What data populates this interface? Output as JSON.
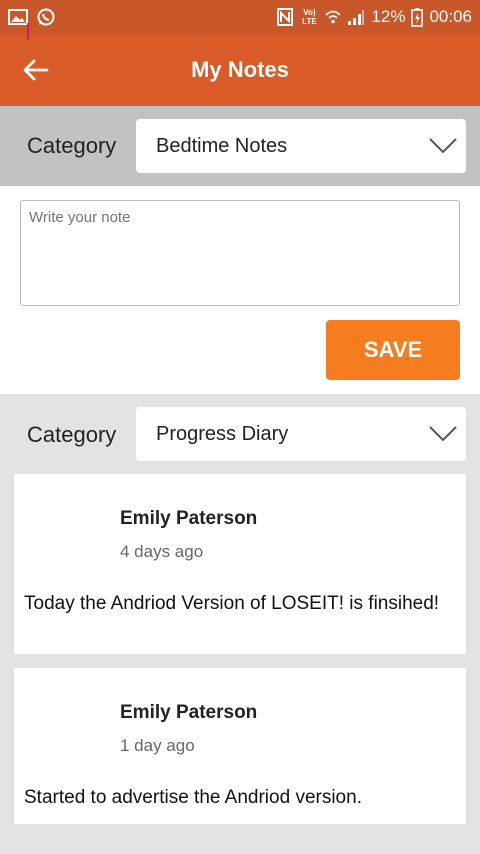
{
  "status_bar": {
    "network": "Vo) LTE",
    "battery": "12%",
    "time": "00:06"
  },
  "app_bar": {
    "title": "My Notes"
  },
  "compose": {
    "category_label": "Category",
    "category_value": "Bedtime Notes",
    "note_placeholder": "Write your note",
    "save_label": "SAVE"
  },
  "feed": {
    "category_label": "Category",
    "category_value": "Progress Diary",
    "posts": [
      {
        "author": "Emily Paterson",
        "time": "4 days ago",
        "text": "Today the Andriod Version of LOSEIT! is finsihed!"
      },
      {
        "author": "Emily Paterson",
        "time": "1 day ago",
        "text": "Started to advertise the Andriod version."
      }
    ]
  },
  "colors": {
    "status_bar": "#c8582a",
    "app_bar": "#d85b28",
    "save_button": "#f57c1f"
  }
}
